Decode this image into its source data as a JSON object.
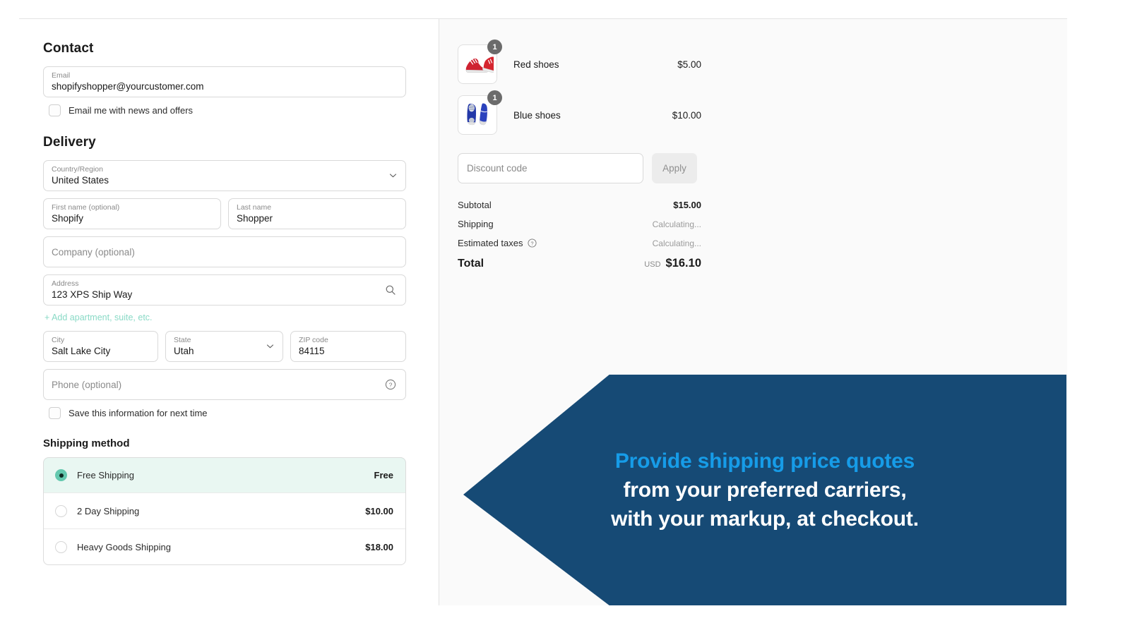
{
  "theme": {
    "panel_bg": "#fafafa",
    "accent_teal": "#63c8ae",
    "link_teal": "#89dac6",
    "banner_navy": "#164a75",
    "banner_accent_blue": "#169ce8"
  },
  "contact": {
    "heading": "Contact",
    "email_label": "Email",
    "email_value": "shopifyshopper@yourcustomer.com",
    "newsletter_label": "Email me with news and offers"
  },
  "delivery": {
    "heading": "Delivery",
    "country_label": "Country/Region",
    "country_value": "United States",
    "first_name_label": "First name (optional)",
    "first_name_value": "Shopify",
    "last_name_label": "Last name",
    "last_name_value": "Shopper",
    "company_placeholder": "Company (optional)",
    "address_label": "Address",
    "address_value": "123 XPS Ship Way",
    "add_apartment_link": "+ Add apartment, suite, etc.",
    "city_label": "City",
    "city_value": "Salt Lake City",
    "state_label": "State",
    "state_value": "Utah",
    "zip_label": "ZIP code",
    "zip_value": "84115",
    "phone_placeholder": "Phone (optional)",
    "save_info_label": "Save this information for next time"
  },
  "shipping": {
    "heading": "Shipping method",
    "options": [
      {
        "name": "Free Shipping",
        "price": "Free",
        "selected": true
      },
      {
        "name": "2 Day Shipping",
        "price": "$10.00",
        "selected": false
      },
      {
        "name": "Heavy Goods Shipping",
        "price": "$18.00",
        "selected": false
      }
    ]
  },
  "summary": {
    "items": [
      {
        "name": "Red shoes",
        "price": "$5.00",
        "qty": "1",
        "thumb": "red-shoes-image"
      },
      {
        "name": "Blue shoes",
        "price": "$10.00",
        "qty": "1",
        "thumb": "blue-shoes-image"
      }
    ],
    "discount_placeholder": "Discount code",
    "apply_label": "Apply",
    "subtotal_label": "Subtotal",
    "subtotal_value": "$15.00",
    "shipping_label": "Shipping",
    "shipping_value": "Calculating...",
    "taxes_label": "Estimated taxes",
    "taxes_value": "Calculating...",
    "total_label": "Total",
    "total_currency": "USD",
    "total_value": "$16.10"
  },
  "banner": {
    "line1": "Provide shipping price quotes",
    "line2": "from your preferred carriers,",
    "line3": "with your markup, at checkout."
  }
}
